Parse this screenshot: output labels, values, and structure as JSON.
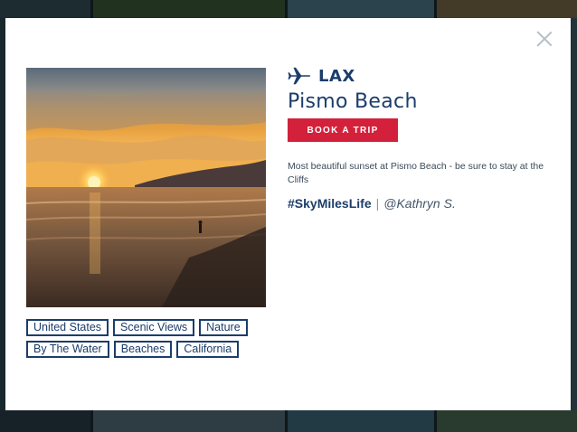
{
  "modal": {
    "close_icon": "close-icon"
  },
  "photo": {
    "subject": "sunset-beach-photo"
  },
  "tags": {
    "row1": [
      "United States",
      "Scenic Views",
      "Nature"
    ],
    "row2": [
      "By The Water",
      "Beaches",
      "California"
    ]
  },
  "info": {
    "airport_icon": "plane-icon",
    "airport": "LAX",
    "destination": "Pismo Beach",
    "book_label": "BOOK A TRIP",
    "description": "Most beautiful sunset at Pismo Beach - be sure to stay at the Cliffs",
    "hashtag": "#SkyMilesLife",
    "separator": "|",
    "handle": "@Kathryn S."
  },
  "colors": {
    "brand_navy": "#1c3d6b",
    "book_red": "#d3213b"
  }
}
